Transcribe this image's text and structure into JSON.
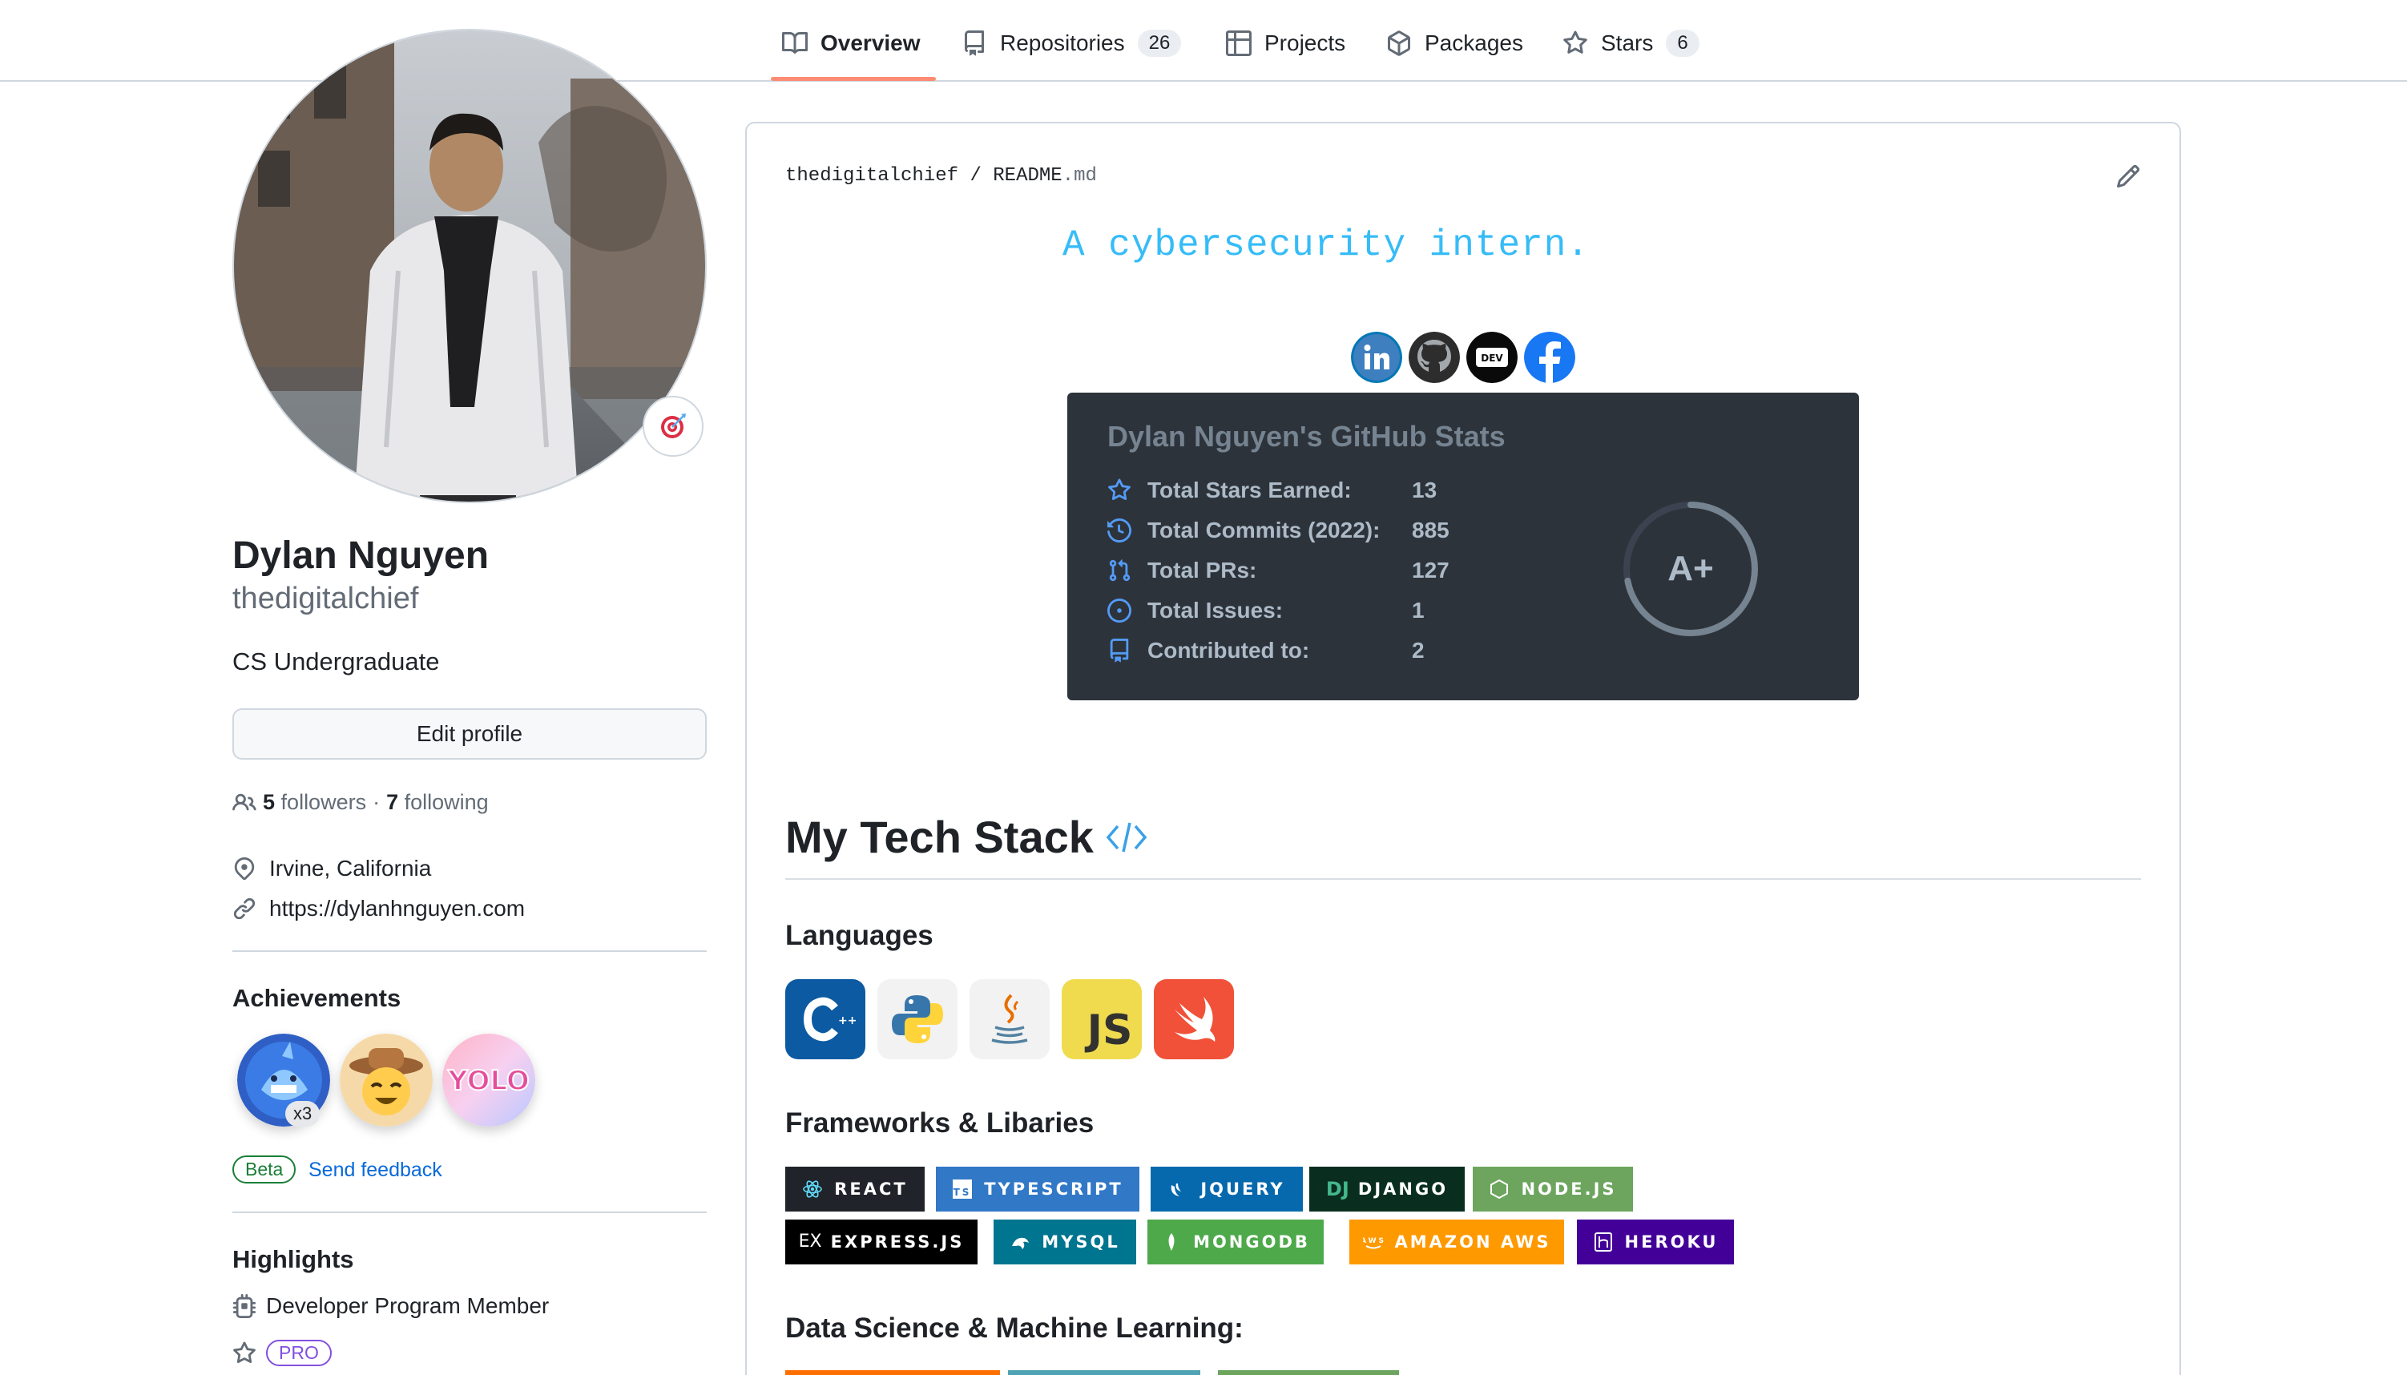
{
  "tabs": [
    {
      "label": "Overview",
      "icon": "book-icon",
      "active": true
    },
    {
      "label": "Repositories",
      "icon": "repo-icon",
      "count": "26"
    },
    {
      "label": "Projects",
      "icon": "table-icon"
    },
    {
      "label": "Packages",
      "icon": "package-icon"
    },
    {
      "label": "Stars",
      "icon": "star-icon",
      "count": "6"
    }
  ],
  "profile": {
    "name": "Dylan Nguyen",
    "login": "thedigitalchief",
    "bio": "CS Undergraduate",
    "edit_label": "Edit profile",
    "followers_count": "5",
    "followers_label": "followers",
    "separator": "·",
    "following_count": "7",
    "following_label": "following",
    "location": "Irvine, California",
    "website": "https://dylanhnguyen.com"
  },
  "achievements": {
    "heading": "Achievements",
    "badge_multiplier": "x3",
    "beta_label": "Beta",
    "feedback_label": "Send feedback"
  },
  "highlights": {
    "heading": "Highlights",
    "item1": "Developer Program Member",
    "pro_label": "PRO"
  },
  "readme": {
    "owner": "thedigitalchief",
    "slash": "/",
    "file": "README",
    "ext": ".md",
    "typing_text": "A cybersecurity intern.",
    "socials": [
      "linkedin-icon",
      "github-icon",
      "dev-icon",
      "facebook-icon"
    ]
  },
  "stats": {
    "title": "Dylan Nguyen's GitHub Stats",
    "rows": [
      {
        "label": "Total Stars Earned:",
        "value": "13"
      },
      {
        "label": "Total Commits (2022):",
        "value": "885"
      },
      {
        "label": "Total PRs:",
        "value": "127"
      },
      {
        "label": "Total Issues:",
        "value": "1"
      },
      {
        "label": "Contributed to:",
        "value": "2"
      }
    ],
    "rank": "A+",
    "rank_progress": 0.72
  },
  "tech": {
    "heading": "My Tech Stack",
    "languages_heading": "Languages",
    "languages": [
      "C++",
      "Python",
      "Java",
      "JS",
      "Swift"
    ],
    "js_label": "JS",
    "frameworks_heading": "Frameworks & Libaries",
    "frameworks": [
      "REACT",
      "TYPESCRIPT",
      "JQUERY",
      "DJANGO",
      "NODE.JS",
      "EXPRESS.JS",
      "MYSQL",
      "MONGODB",
      "AMAZON AWS",
      "HEROKU"
    ],
    "ds_heading": "Data Science & Machine Learning:"
  },
  "colors": {
    "accent_underline": "#fd8c73",
    "link": "#0969da",
    "stats_bg": "#2d333b",
    "typing": "#36bcf7"
  }
}
